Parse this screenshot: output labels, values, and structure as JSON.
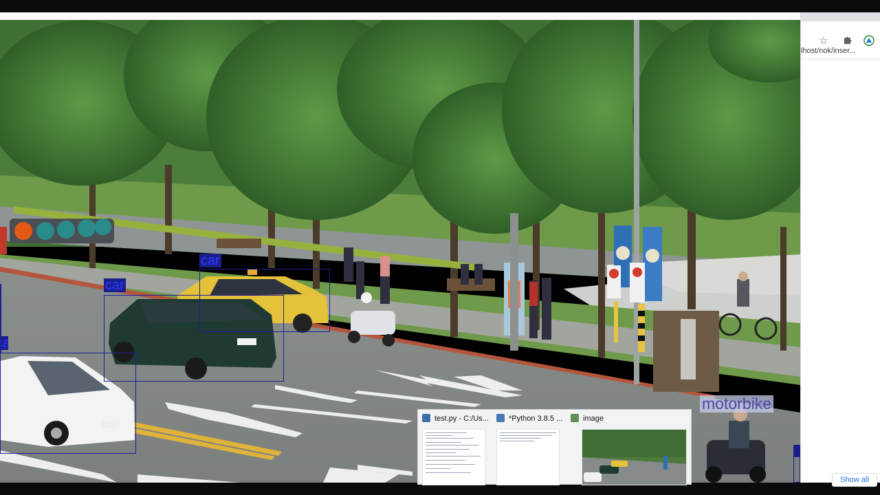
{
  "browser": {
    "url_text": "lhost/nok/inser...",
    "bookmark_icon": "star-icon",
    "extensions_icon": "puzzle-icon",
    "profile_icon": "extension-logo-icon",
    "show_all_label": "Show all"
  },
  "detections": [
    {
      "label": "car"
    },
    {
      "label": "car"
    },
    {
      "label": "car"
    },
    {
      "label": "motorbike"
    },
    {
      "label": ""
    }
  ],
  "taskbar_thumbnails": [
    {
      "title": "test.py - C:/Us...",
      "icon": "python-file-icon"
    },
    {
      "title": "*Python 3.8.5 ...",
      "icon": "python-shell-icon"
    },
    {
      "title": "image",
      "icon": "image-window-icon"
    }
  ],
  "colors": {
    "detection_box": "#1c1f9a",
    "detection_label_bg": "#1b1f8e",
    "detection_label_text": "#2b3aff",
    "taxi_yellow": "#e4c23a"
  }
}
